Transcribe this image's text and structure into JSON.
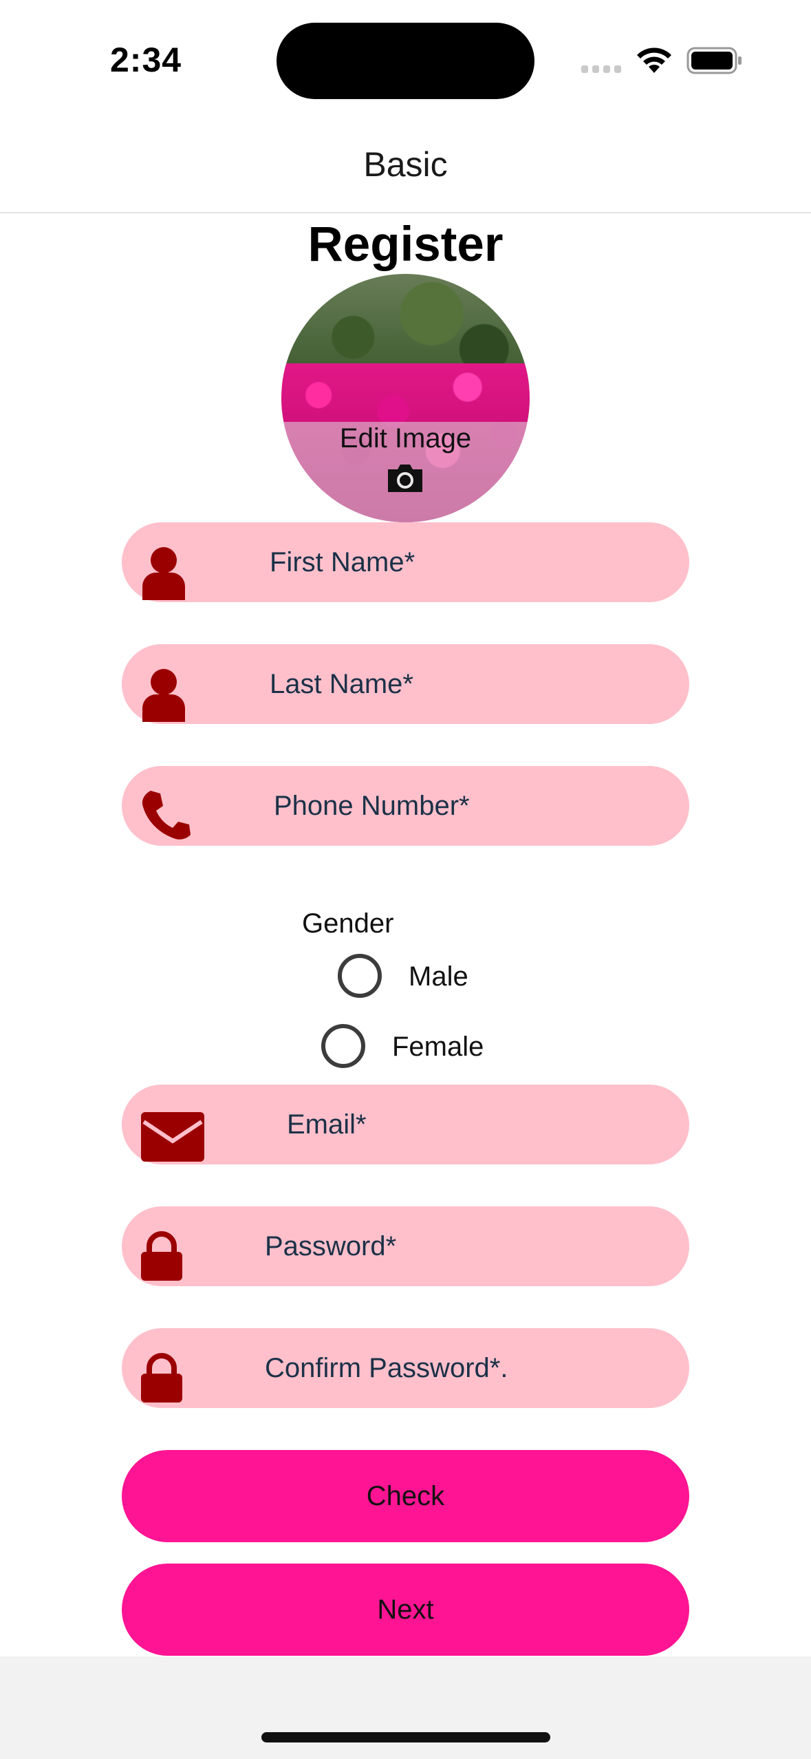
{
  "status_bar": {
    "time": "2:34"
  },
  "nav": {
    "title": "Basic"
  },
  "header": {
    "title": "Register"
  },
  "avatar": {
    "edit_label": "Edit Image"
  },
  "form": {
    "first_name": {
      "placeholder": "First Name*",
      "icon": "person-icon"
    },
    "last_name": {
      "placeholder": "Last Name*",
      "icon": "person-icon"
    },
    "phone": {
      "placeholder": "Phone Number*",
      "icon": "phone-icon"
    },
    "gender": {
      "label": "Gender",
      "options": [
        "Male",
        "Female"
      ],
      "selected": null
    },
    "email": {
      "placeholder": "Email*",
      "icon": "envelope-icon"
    },
    "password": {
      "placeholder": "Password*",
      "icon": "lock-icon"
    },
    "confirm_password": {
      "placeholder": "Confirm Password*.",
      "icon": "lock-icon"
    }
  },
  "buttons": {
    "check": "Check",
    "next": "Next"
  },
  "colors": {
    "field_bg": "#ffc0cb",
    "icon_color": "#9b0000",
    "button_bg": "#ff1493",
    "placeholder_text": "#1b3148"
  }
}
